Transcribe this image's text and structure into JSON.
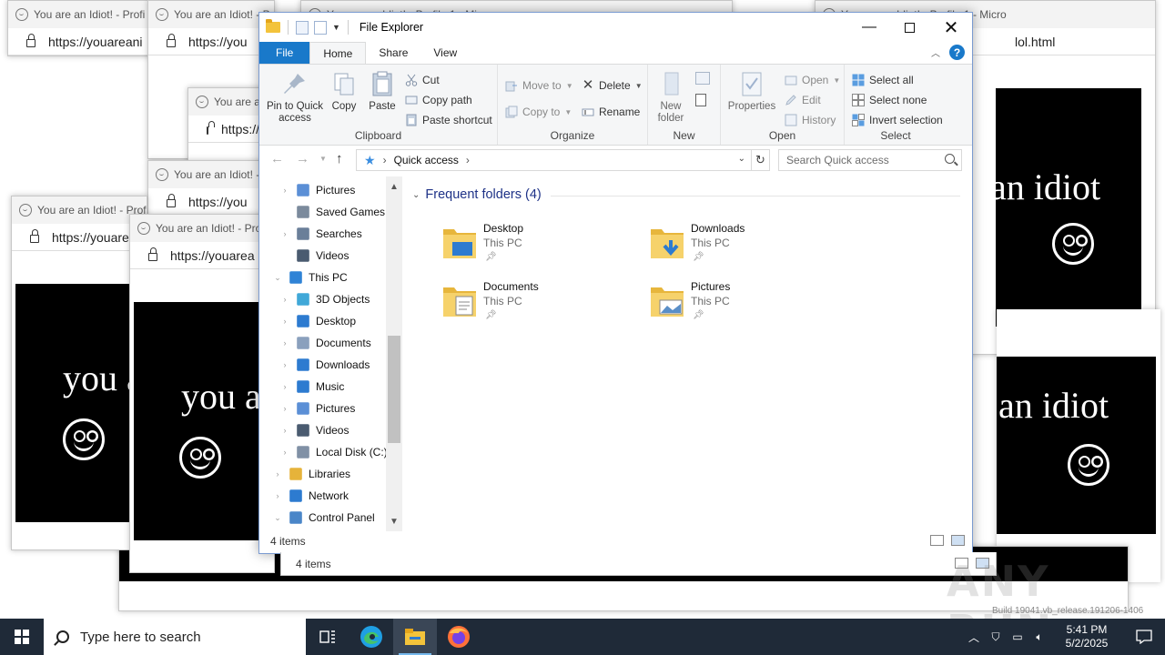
{
  "browser_windows": {
    "tab_title": "You are an Idiot! - Profile 1 - Micro",
    "tab_title_short": "You are an Idiot! - Profi",
    "tab_title_mid": "You are an Idiot! - Profile",
    "url": "https://youareanidiot.cc/lol.html",
    "url_short": "https://youareani",
    "url_shorter": "https://you",
    "url_mid": "https://youarea",
    "url_tail": "lol.html",
    "page_text": "you are an idiot",
    "page_text_left": "you a",
    "page_text_right": "an idiot"
  },
  "explorer": {
    "title": "File Explorer",
    "tabs": {
      "file": "File",
      "home": "Home",
      "share": "Share",
      "view": "View"
    },
    "ribbon": {
      "clipboard": {
        "label": "Clipboard",
        "pin": "Pin to Quick access",
        "copy": "Copy",
        "paste": "Paste",
        "cut": "Cut",
        "copy_path": "Copy path",
        "paste_shortcut": "Paste shortcut"
      },
      "organize": {
        "label": "Organize",
        "move_to": "Move to",
        "copy_to": "Copy to",
        "delete": "Delete",
        "rename": "Rename"
      },
      "new": {
        "label": "New",
        "new_folder": "New folder"
      },
      "open": {
        "label": "Open",
        "properties": "Properties",
        "open": "Open",
        "edit": "Edit",
        "history": "History"
      },
      "select": {
        "label": "Select",
        "select_all": "Select all",
        "select_none": "Select none",
        "invert": "Invert selection"
      }
    },
    "address": {
      "location": "Quick access"
    },
    "search": {
      "placeholder": "Search Quick access"
    },
    "nav": {
      "items": [
        {
          "label": "Pictures",
          "icon": "pictures-icon"
        },
        {
          "label": "Saved Games",
          "icon": "saved-games-icon"
        },
        {
          "label": "Searches",
          "icon": "search-icon"
        },
        {
          "label": "Videos",
          "icon": "videos-icon"
        },
        {
          "label": "This PC",
          "icon": "this-pc-icon"
        },
        {
          "label": "3D Objects",
          "icon": "3d-objects-icon"
        },
        {
          "label": "Desktop",
          "icon": "desktop-icon"
        },
        {
          "label": "Documents",
          "icon": "documents-icon"
        },
        {
          "label": "Downloads",
          "icon": "downloads-icon"
        },
        {
          "label": "Music",
          "icon": "music-icon"
        },
        {
          "label": "Pictures",
          "icon": "pictures-icon"
        },
        {
          "label": "Videos",
          "icon": "videos-icon"
        },
        {
          "label": "Local Disk (C:)",
          "icon": "disk-icon"
        },
        {
          "label": "Libraries",
          "icon": "libraries-icon"
        },
        {
          "label": "Network",
          "icon": "network-icon"
        },
        {
          "label": "Control Panel",
          "icon": "control-panel-icon"
        }
      ]
    },
    "main": {
      "section_title": "Frequent folders (4)",
      "folders": [
        {
          "name": "Desktop",
          "location": "This PC",
          "icon": "desktop-folder-icon"
        },
        {
          "name": "Downloads",
          "location": "This PC",
          "icon": "downloads-folder-icon"
        },
        {
          "name": "Documents",
          "location": "This PC",
          "icon": "documents-folder-icon"
        },
        {
          "name": "Pictures",
          "location": "This PC",
          "icon": "pictures-folder-icon"
        }
      ]
    },
    "status": {
      "items": "4 items"
    }
  },
  "taskbar": {
    "search_placeholder": "Type here to search",
    "time": "5:41 PM",
    "date": "5/2/2025"
  },
  "watermark": {
    "brand": "ANY RUN",
    "build": "Build 19041.vb_release.191206-1406"
  }
}
